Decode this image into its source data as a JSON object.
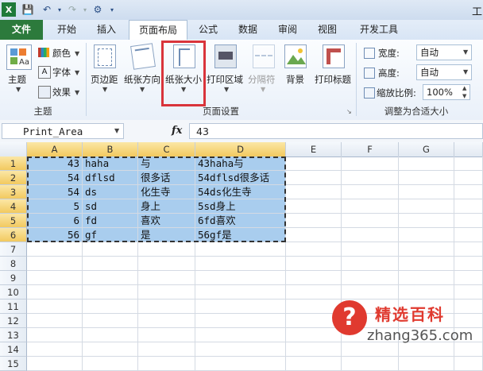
{
  "title_bar": {
    "right_text": "工"
  },
  "tabs": [
    "文件",
    "开始",
    "插入",
    "页面布局",
    "公式",
    "数据",
    "审阅",
    "视图",
    "开发工具"
  ],
  "ribbon": {
    "theme": {
      "main": "主题",
      "colors": "颜色",
      "fonts": "字体",
      "effects": "效果",
      "group": "主题"
    },
    "page_setup": {
      "margins": "页边距",
      "orientation": "纸张方向",
      "size": "纸张大小",
      "print_area": "打印区域",
      "breaks": "分隔符",
      "background": "背景",
      "print_titles": "打印标题",
      "group": "页面设置"
    },
    "scale": {
      "width_label": "宽度:",
      "width_value": "自动",
      "height_label": "高度:",
      "height_value": "自动",
      "scale_label": "缩放比例:",
      "scale_value": "100%",
      "group": "调整为合适大小"
    }
  },
  "formula_bar": {
    "name_box": "Print_Area",
    "fx": "fx",
    "value": "43"
  },
  "columns": [
    "A",
    "B",
    "C",
    "D",
    "E",
    "F",
    "G"
  ],
  "rows": [
    {
      "n": "1",
      "a": "43",
      "b": "haha",
      "c": "与",
      "d": "43haha与"
    },
    {
      "n": "2",
      "a": "54",
      "b": "dflsd",
      "c": "很多话",
      "d": "54dflsd很多话"
    },
    {
      "n": "3",
      "a": "54",
      "b": "ds",
      "c": "化生寺",
      "d": "54ds化生寺"
    },
    {
      "n": "4",
      "a": "5",
      "b": "sd",
      "c": "身上",
      "d": "5sd身上"
    },
    {
      "n": "5",
      "a": "6",
      "b": "fd",
      "c": "喜欢",
      "d": "6fd喜欢"
    },
    {
      "n": "6",
      "a": "56",
      "b": "gf",
      "c": "是",
      "d": "56gf是"
    },
    {
      "n": "7",
      "a": "",
      "b": "",
      "c": "",
      "d": ""
    },
    {
      "n": "8",
      "a": "",
      "b": "",
      "c": "",
      "d": ""
    },
    {
      "n": "9",
      "a": "",
      "b": "",
      "c": "",
      "d": ""
    },
    {
      "n": "10",
      "a": "",
      "b": "",
      "c": "",
      "d": ""
    },
    {
      "n": "11",
      "a": "",
      "b": "",
      "c": "",
      "d": ""
    },
    {
      "n": "12",
      "a": "",
      "b": "",
      "c": "",
      "d": ""
    },
    {
      "n": "13",
      "a": "",
      "b": "",
      "c": "",
      "d": ""
    },
    {
      "n": "14",
      "a": "",
      "b": "",
      "c": "",
      "d": ""
    },
    {
      "n": "15",
      "a": "",
      "b": "",
      "c": "",
      "d": ""
    }
  ],
  "watermark": {
    "brand": "精选百科",
    "url": "zhang365.com",
    "icon": "question-mark-icon"
  },
  "colors": {
    "file_tab": "#2c7a3c",
    "selection": "#a9cdee",
    "highlight_box": "#d9343b",
    "watermark_red": "#e03a2f"
  }
}
